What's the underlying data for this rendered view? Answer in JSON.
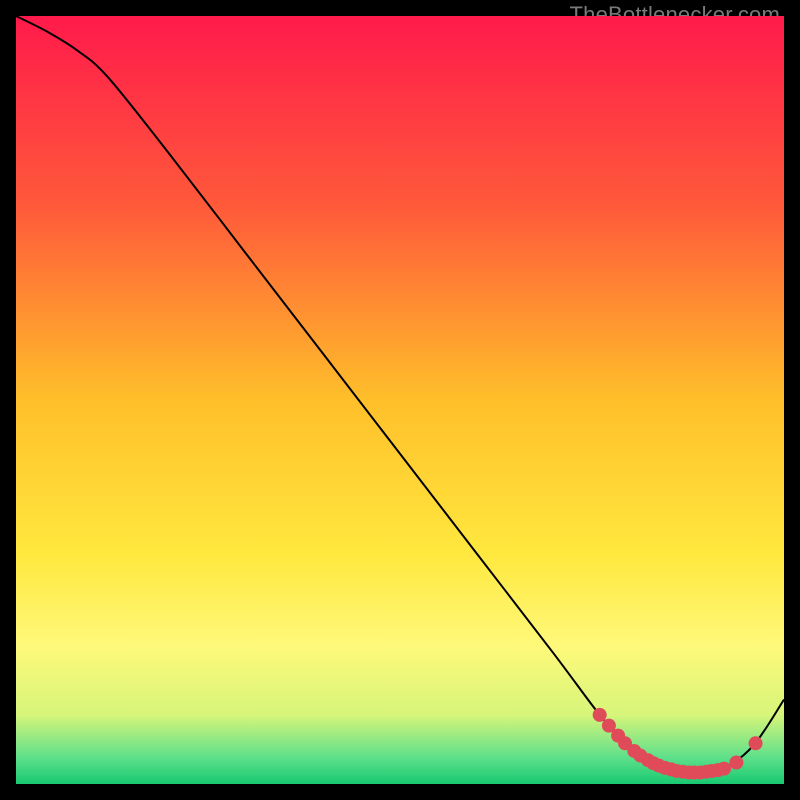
{
  "attribution": "TheBottlenecker.com",
  "chart_data": {
    "type": "line",
    "title": "",
    "xlabel": "",
    "ylabel": "",
    "xlim": [
      0,
      100
    ],
    "ylim": [
      0,
      100
    ],
    "grid": false,
    "legend": false,
    "background_gradient": {
      "stops": [
        {
          "offset": 0.0,
          "color": "#ff1a4b"
        },
        {
          "offset": 0.25,
          "color": "#ff5a3a"
        },
        {
          "offset": 0.5,
          "color": "#ffbf2a"
        },
        {
          "offset": 0.7,
          "color": "#ffe83e"
        },
        {
          "offset": 0.82,
          "color": "#fff97a"
        },
        {
          "offset": 0.91,
          "color": "#d6f57a"
        },
        {
          "offset": 0.965,
          "color": "#5fe08a"
        },
        {
          "offset": 1.0,
          "color": "#17c972"
        }
      ]
    },
    "series": [
      {
        "name": "curve",
        "color": "#000000",
        "line_width": 2,
        "x": [
          0,
          4,
          8,
          12,
          20,
          30,
          40,
          50,
          60,
          70,
          76,
          80,
          84,
          88,
          92,
          96,
          100
        ],
        "y": [
          100,
          98,
          95.5,
          92,
          82,
          69,
          56,
          43,
          30,
          17,
          9,
          4.5,
          2.0,
          1.5,
          2.0,
          5.0,
          11
        ]
      }
    ],
    "markers": {
      "name": "highlight-points",
      "color": "#e04b5a",
      "radius": 7,
      "x": [
        76.0,
        77.2,
        78.4,
        79.3,
        80.5,
        81.3,
        82.3,
        83.0,
        83.7,
        84.5,
        85.3,
        86.0,
        86.8,
        87.6,
        88.3,
        89.1,
        89.9,
        90.6,
        91.4,
        92.2,
        93.8,
        96.3
      ],
      "y": [
        9.0,
        7.6,
        6.3,
        5.3,
        4.3,
        3.7,
        3.1,
        2.7,
        2.4,
        2.1,
        1.9,
        1.7,
        1.6,
        1.5,
        1.5,
        1.5,
        1.6,
        1.7,
        1.8,
        2.0,
        2.8,
        5.3
      ]
    }
  }
}
